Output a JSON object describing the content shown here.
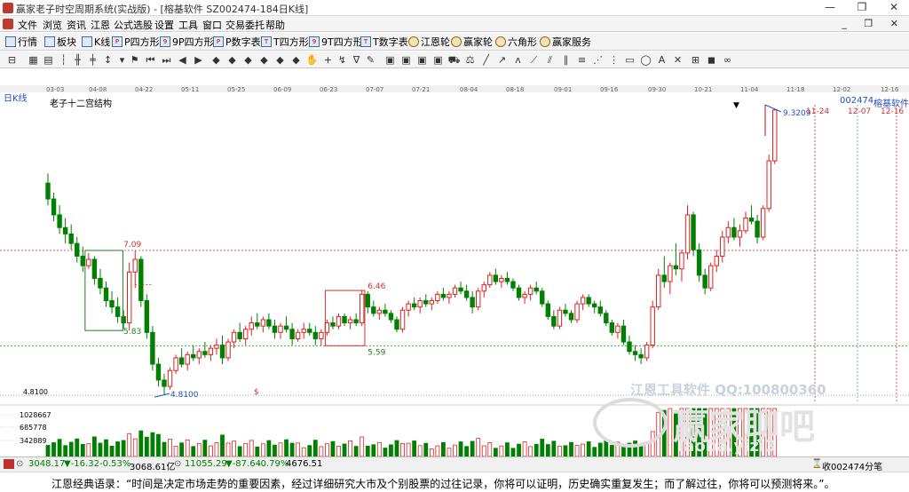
{
  "window": {
    "title": "赢家老子时空周期系统(实战版) - [榕基软件  SZ002474-184日K线]",
    "min": "—",
    "max": "❐",
    "close": "✕"
  },
  "menu": {
    "items": [
      "文件",
      "浏览",
      "资讯",
      "江恩",
      "公式选股",
      "设置",
      "工具",
      "窗口",
      "交易委托",
      "帮助"
    ],
    "mdi": "_ ❐ ✕"
  },
  "toolbar1": {
    "items": [
      "行情",
      "板块",
      "K线",
      "P四方形",
      "9P四方形",
      "P数字表",
      "T四方形",
      "9T四方形",
      "T数字表",
      "江恩轮",
      "赢家轮",
      "六角形",
      "赢家服务"
    ]
  },
  "chart": {
    "label_type": "日K线",
    "study_name": "老子十二宫结构",
    "code": "002474",
    "name": "榕基软件",
    "date_labels": [
      "03-03",
      "04-08",
      "04-22",
      "05-11",
      "05-25",
      "06-09",
      "06-23",
      "07-07",
      "07-21",
      "08-04",
      "08-18",
      "09-01",
      "09-16",
      "09-30",
      "10-21",
      "11-04",
      "11-18",
      "12-02",
      "12-16"
    ],
    "future_dates": [
      "11-24",
      "12-07",
      "12-16"
    ],
    "price_labels": {
      "p709": "7.09",
      "p583": "5.83",
      "p646": "6.46",
      "p559": "5.59",
      "low": "4.8100",
      "low_axis": "4.8100",
      "high": "9.3209",
      "dollar": "$"
    },
    "volume_labels": [
      "1028667",
      "685778",
      "342889"
    ],
    "watermark1": "江恩工具软件  QQ:100800360",
    "watermark2": "赢家聊吧",
    "watermark3": "laoba.yizi3"
  },
  "chart_data": {
    "type": "candlestick",
    "series": [
      {
        "name": "K线",
        "values": [
          [
            8.15,
            8.3,
            7.8,
            7.9
          ],
          [
            7.9,
            8.0,
            7.55,
            7.65
          ],
          [
            7.65,
            7.8,
            7.35,
            7.45
          ],
          [
            7.45,
            7.6,
            7.2,
            7.35
          ],
          [
            7.35,
            7.5,
            7.1,
            7.2
          ],
          [
            7.2,
            7.3,
            6.9,
            7.0
          ],
          [
            7.0,
            7.15,
            6.75,
            6.85
          ],
          [
            6.85,
            7.05,
            6.8,
            6.95
          ],
          [
            6.95,
            7.0,
            6.55,
            6.65
          ],
          [
            6.65,
            6.8,
            6.4,
            6.5
          ],
          [
            6.5,
            6.6,
            6.2,
            6.3
          ],
          [
            6.3,
            6.45,
            6.1,
            6.2
          ],
          [
            6.2,
            6.35,
            5.95,
            6.05
          ],
          [
            6.05,
            6.15,
            5.85,
            5.95
          ],
          [
            5.95,
            6.9,
            5.83,
            6.75
          ],
          [
            6.75,
            7.09,
            6.5,
            6.95
          ],
          [
            6.95,
            7.0,
            6.2,
            6.3
          ],
          [
            6.3,
            6.4,
            5.7,
            5.8
          ],
          [
            5.8,
            5.9,
            5.2,
            5.3
          ],
          [
            5.3,
            5.4,
            4.95,
            5.05
          ],
          [
            5.05,
            5.15,
            4.81,
            4.95
          ],
          [
            4.95,
            5.25,
            4.9,
            5.2
          ],
          [
            5.2,
            5.45,
            5.15,
            5.4
          ],
          [
            5.4,
            5.55,
            5.25,
            5.3
          ],
          [
            5.3,
            5.5,
            5.2,
            5.45
          ],
          [
            5.45,
            5.6,
            5.35,
            5.4
          ],
          [
            5.4,
            5.55,
            5.3,
            5.5
          ],
          [
            5.5,
            5.65,
            5.4,
            5.45
          ],
          [
            5.45,
            5.6,
            5.35,
            5.55
          ],
          [
            5.55,
            5.7,
            5.45,
            5.6
          ],
          [
            5.6,
            5.75,
            5.3,
            5.4
          ],
          [
            5.4,
            5.7,
            5.35,
            5.65
          ],
          [
            5.65,
            5.85,
            5.55,
            5.8
          ],
          [
            5.8,
            5.95,
            5.65,
            5.7
          ],
          [
            5.7,
            5.9,
            5.6,
            5.85
          ],
          [
            5.85,
            6.05,
            5.75,
            5.95
          ],
          [
            5.95,
            6.1,
            5.85,
            5.9
          ],
          [
            5.9,
            6.05,
            5.8,
            6.0
          ],
          [
            6.0,
            6.1,
            5.85,
            5.9
          ],
          [
            5.9,
            6.0,
            5.7,
            5.8
          ],
          [
            5.8,
            5.95,
            5.7,
            5.9
          ],
          [
            5.9,
            6.05,
            5.8,
            5.85
          ],
          [
            5.85,
            5.95,
            5.6,
            5.7
          ],
          [
            5.7,
            5.85,
            5.65,
            5.8
          ],
          [
            5.8,
            5.95,
            5.7,
            5.85
          ],
          [
            5.85,
            5.95,
            5.75,
            5.8
          ],
          [
            5.8,
            5.9,
            5.6,
            5.7
          ],
          [
            5.7,
            5.85,
            5.59,
            5.8
          ],
          [
            5.8,
            6.0,
            5.75,
            5.95
          ],
          [
            5.95,
            6.05,
            5.85,
            5.9
          ],
          [
            5.9,
            6.1,
            5.85,
            6.05
          ],
          [
            6.05,
            6.1,
            5.9,
            5.95
          ],
          [
            5.95,
            6.05,
            5.85,
            6.0
          ],
          [
            6.0,
            6.1,
            5.9,
            5.95
          ],
          [
            5.95,
            6.46,
            5.9,
            6.4
          ],
          [
            6.4,
            6.45,
            6.1,
            6.2
          ],
          [
            6.2,
            6.3,
            6.05,
            6.1
          ],
          [
            6.1,
            6.2,
            6.0,
            6.15
          ],
          [
            6.15,
            6.25,
            6.05,
            6.1
          ],
          [
            6.1,
            6.15,
            5.95,
            6.0
          ],
          [
            6.0,
            6.05,
            5.8,
            5.85
          ],
          [
            5.85,
            6.2,
            5.8,
            6.15
          ],
          [
            6.15,
            6.3,
            6.05,
            6.25
          ],
          [
            6.25,
            6.35,
            6.15,
            6.2
          ],
          [
            6.2,
            6.35,
            6.1,
            6.3
          ],
          [
            6.3,
            6.4,
            6.2,
            6.25
          ],
          [
            6.25,
            6.35,
            6.15,
            6.3
          ],
          [
            6.3,
            6.45,
            6.25,
            6.4
          ],
          [
            6.4,
            6.5,
            6.3,
            6.35
          ],
          [
            6.35,
            6.45,
            6.25,
            6.4
          ],
          [
            6.4,
            6.55,
            6.35,
            6.5
          ],
          [
            6.5,
            6.6,
            6.4,
            6.45
          ],
          [
            6.45,
            6.55,
            6.3,
            6.35
          ],
          [
            6.35,
            6.45,
            6.1,
            6.2
          ],
          [
            6.2,
            6.5,
            6.15,
            6.45
          ],
          [
            6.45,
            6.6,
            6.35,
            6.55
          ],
          [
            6.55,
            6.75,
            6.5,
            6.7
          ],
          [
            6.7,
            6.8,
            6.55,
            6.6
          ],
          [
            6.6,
            6.7,
            6.5,
            6.65
          ],
          [
            6.65,
            6.75,
            6.55,
            6.6
          ],
          [
            6.6,
            6.65,
            6.45,
            6.5
          ],
          [
            6.5,
            6.55,
            6.3,
            6.35
          ],
          [
            6.35,
            6.45,
            6.25,
            6.4
          ],
          [
            6.4,
            6.55,
            6.3,
            6.5
          ],
          [
            6.5,
            6.6,
            6.4,
            6.45
          ],
          [
            6.45,
            6.5,
            6.2,
            6.25
          ],
          [
            6.25,
            6.3,
            6.0,
            6.05
          ],
          [
            6.05,
            6.15,
            5.85,
            5.9
          ],
          [
            5.9,
            6.2,
            5.85,
            6.15
          ],
          [
            6.15,
            6.25,
            6.05,
            6.1
          ],
          [
            6.1,
            6.15,
            5.95,
            6.0
          ],
          [
            6.0,
            6.3,
            5.95,
            6.25
          ],
          [
            6.25,
            6.4,
            6.15,
            6.35
          ],
          [
            6.35,
            6.4,
            6.2,
            6.25
          ],
          [
            6.25,
            6.3,
            6.1,
            6.2
          ],
          [
            6.2,
            6.3,
            6.05,
            6.1
          ],
          [
            6.1,
            6.15,
            5.9,
            5.95
          ],
          [
            5.95,
            6.0,
            5.75,
            5.8
          ],
          [
            5.8,
            5.95,
            5.7,
            5.9
          ],
          [
            5.9,
            6.0,
            5.6,
            5.65
          ],
          [
            5.65,
            5.75,
            5.45,
            5.5
          ],
          [
            5.5,
            5.6,
            5.35,
            5.45
          ],
          [
            5.45,
            5.55,
            5.3,
            5.4
          ],
          [
            5.4,
            5.65,
            5.35,
            5.6
          ],
          [
            5.6,
            6.3,
            5.55,
            6.2
          ],
          [
            6.2,
            6.8,
            6.15,
            6.7
          ],
          [
            6.7,
            7.0,
            6.5,
            6.6
          ],
          [
            6.6,
            6.9,
            6.4,
            6.85
          ],
          [
            6.85,
            7.2,
            6.7,
            6.8
          ],
          [
            6.8,
            7.1,
            6.6,
            7.05
          ],
          [
            7.05,
            7.8,
            6.95,
            7.65
          ],
          [
            7.65,
            7.7,
            7.0,
            7.1
          ],
          [
            7.1,
            7.2,
            6.6,
            6.7
          ],
          [
            6.7,
            6.8,
            6.4,
            6.5
          ],
          [
            6.5,
            6.9,
            6.45,
            6.85
          ],
          [
            6.85,
            7.1,
            6.75,
            7.0
          ],
          [
            7.0,
            7.4,
            6.9,
            7.3
          ],
          [
            7.3,
            7.55,
            7.2,
            7.45
          ],
          [
            7.45,
            7.6,
            7.25,
            7.3
          ],
          [
            7.3,
            7.5,
            7.15,
            7.4
          ],
          [
            7.4,
            7.7,
            7.35,
            7.6
          ],
          [
            7.6,
            7.8,
            7.5,
            7.55
          ],
          [
            7.55,
            7.65,
            7.2,
            7.3
          ],
          [
            7.3,
            7.8,
            7.25,
            7.75
          ],
          [
            7.75,
            8.6,
            7.7,
            8.5
          ],
          [
            8.5,
            9.32,
            8.45,
            9.3
          ]
        ]
      }
    ],
    "xlabel": "",
    "ylabel": ""
  },
  "status": {
    "sh_value": "3048.17",
    "sh_change": "▼-16.32",
    "sh_pct": "-0.53%",
    "sh_amount": "3068.61亿",
    "sz_value": "11055.29",
    "sz_change": "▼-87.64",
    "sz_pct": "-0.79%",
    "sz_amount": "4676.51",
    "right_label": "收002474分笔"
  },
  "quote": "江恩经典语录：“时间是决定市场走势的重要因素，经过详细研究大市及个别股票的过往记录，你将可以证明，历史确实重复发生；而了解过往，你将可以预测将来。”。"
}
